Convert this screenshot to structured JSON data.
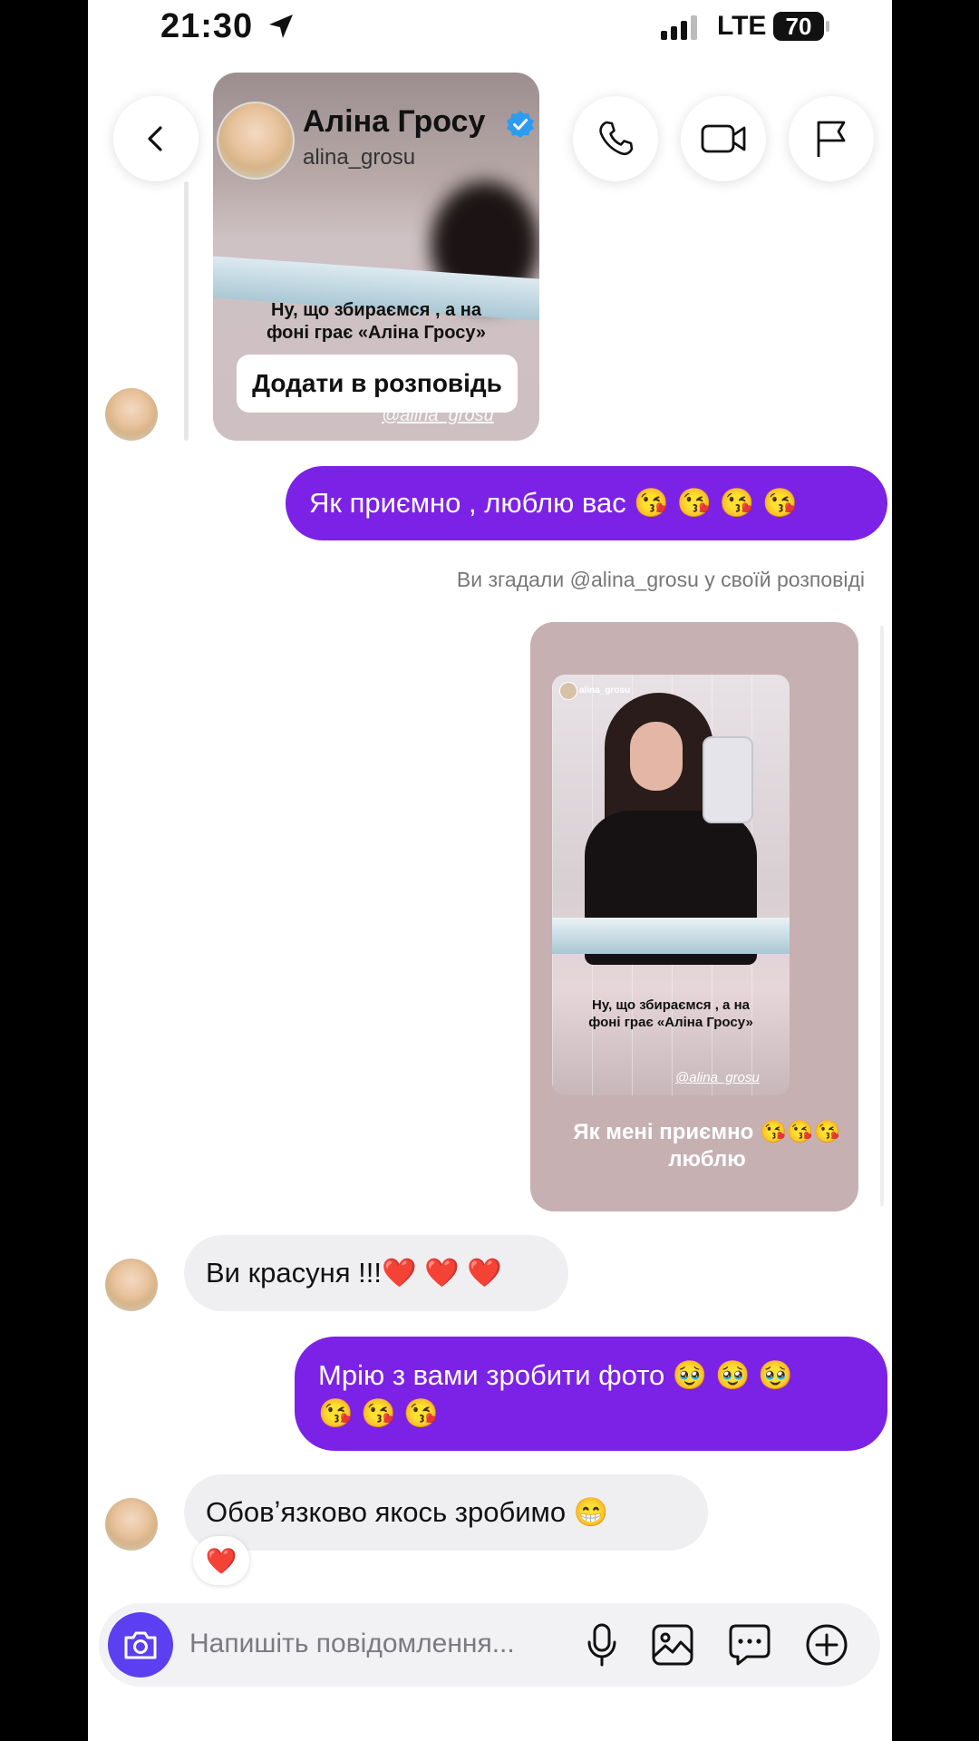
{
  "status_bar": {
    "time": "21:30",
    "network": "LTE",
    "battery": "70"
  },
  "header": {
    "name": "Аліна Гросу",
    "username": "alina_grosu"
  },
  "story_reply": {
    "caption_line1": "Ну, що збираємся , а на",
    "caption_line2": "фоні грає «Аліна Гросу»",
    "add_button": "Додати в розповідь",
    "tag": "@alina_grosu"
  },
  "messages": {
    "m1": "Як приємно , люблю вас 😘 😘 😘 😘",
    "mention_notice": "Ви згадали @alina_grosu у своїй розповіді",
    "m3": "Ви красуня !!!❤️ ❤️ ❤️",
    "m4_line1": "Мрію з вами зробити фото 🥹 🥹 🥹",
    "m4_line2": "😘 😘 😘",
    "m5": "Обовʼязково якось зробимо 😁",
    "m5_reaction": "❤️"
  },
  "shared_story": {
    "username": "alina_grosu",
    "caption_line1": "Ну, що збираємся , а на",
    "caption_line2": "фоні грає «Аліна Гросу»",
    "tag": "@alina_grosu",
    "note_line1": "Як мені приємно 😘😘😘",
    "note_line2": "люблю"
  },
  "composer": {
    "placeholder": "Напишіть повідомлення..."
  },
  "colors": {
    "outgoing_bubble": "#7b22e6",
    "incoming_bubble": "#efeff2",
    "camera_button": "#5b3ff0",
    "verified": "#2c9cf0"
  }
}
